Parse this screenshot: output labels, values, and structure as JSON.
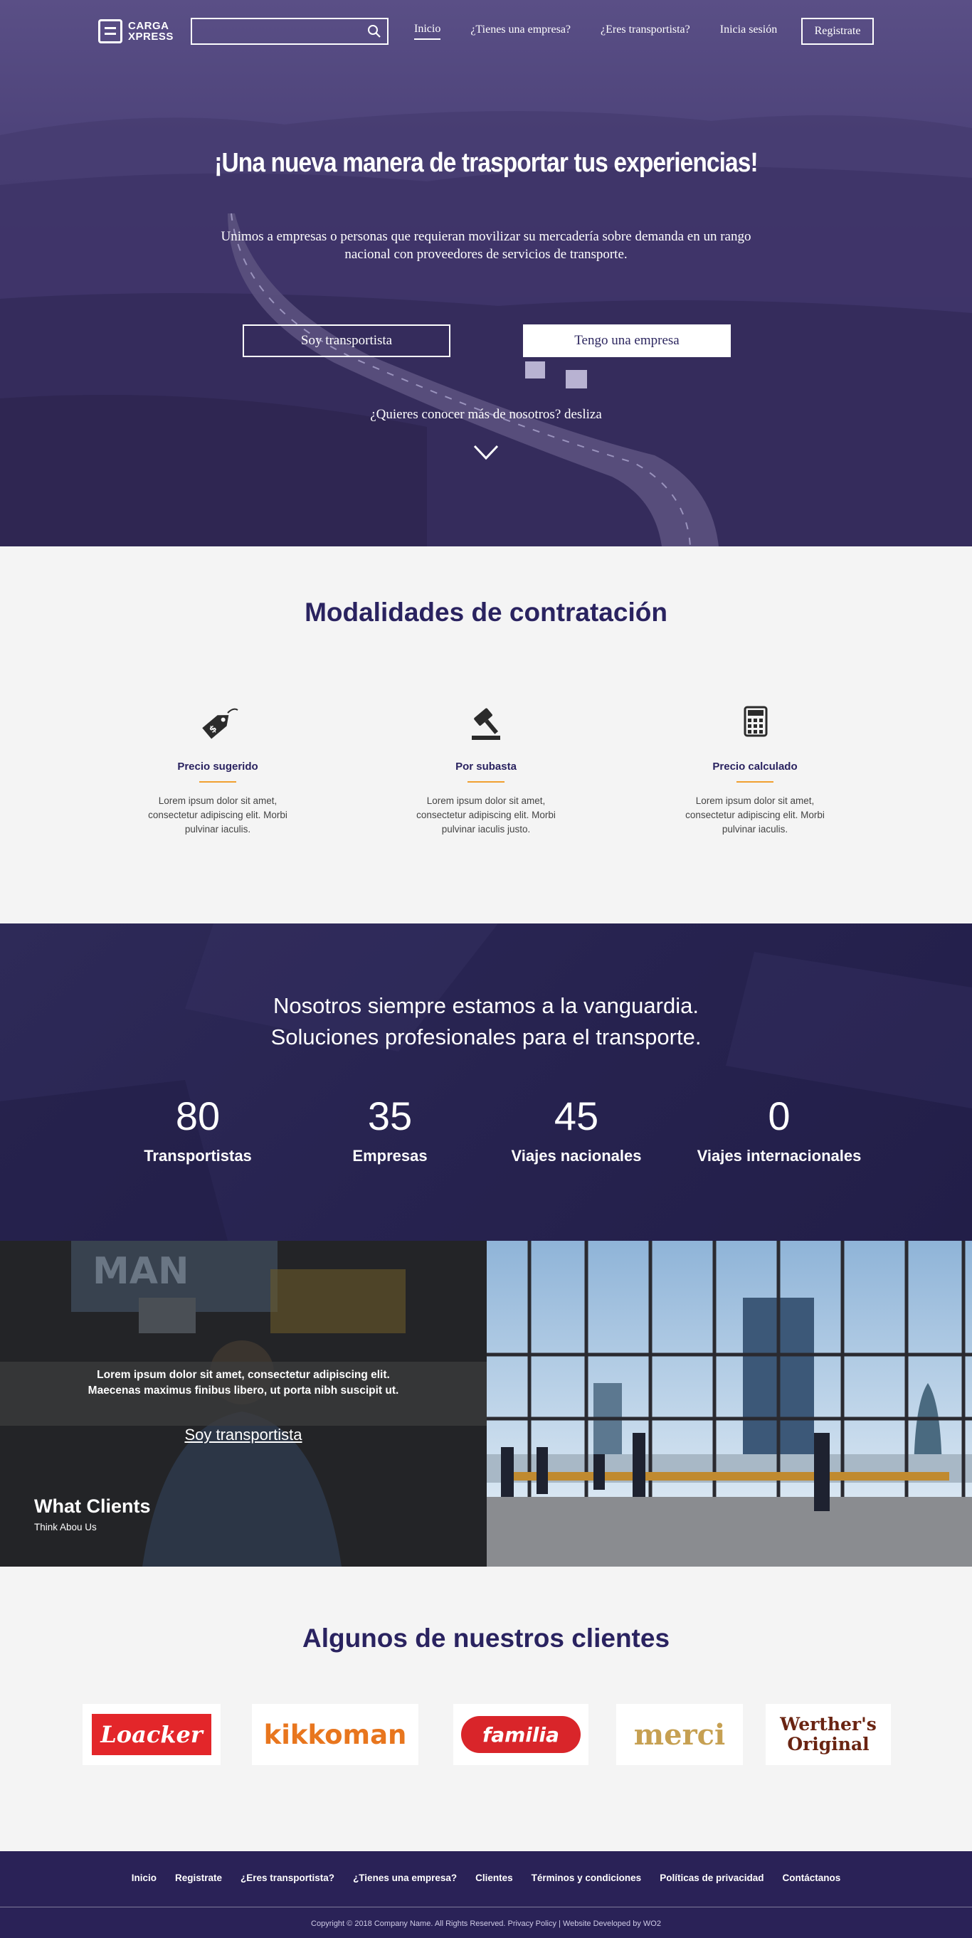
{
  "nav": {
    "logo_line1": "CARGA",
    "logo_line2": "XPRESS",
    "search_placeholder": "",
    "links": [
      "Inicio",
      "¿Tienes una empresa?",
      "¿Eres transportista?",
      "Inicia sesión"
    ],
    "register": "Registrate"
  },
  "hero": {
    "title": "¡Una nueva manera de trasportar tus experiencias!",
    "subtitle": "Unimos a empresas o personas que requieran movilizar su mercadería sobre demanda en un rango nacional con proveedores de servicios de transporte.",
    "btn_transportista": "Soy transportista",
    "btn_empresa": "Tengo una empresa",
    "scroll_text": "¿Quieres conocer más de nosotros? desliza"
  },
  "modes": {
    "title": "Modalidades de contratación",
    "items": [
      {
        "name": "Precio sugerido",
        "icon": "price-tag-icon",
        "desc": "Lorem ipsum dolor sit amet, consectetur adipiscing elit. Morbi pulvinar iaculis."
      },
      {
        "name": "Por subasta",
        "icon": "gavel-icon",
        "desc": "Lorem ipsum dolor sit amet, consectetur adipiscing elit. Morbi pulvinar iaculis justo."
      },
      {
        "name": "Precio calculado",
        "icon": "calculator-icon",
        "desc": "Lorem ipsum dolor sit amet, consectetur adipiscing elit. Morbi pulvinar iaculis."
      }
    ]
  },
  "stats": {
    "heading_line1": "Nosotros siempre estamos a la vanguardia.",
    "heading_line2": "Soluciones profesionales para el transporte.",
    "items": [
      {
        "value": "80",
        "label": "Transportistas"
      },
      {
        "value": "35",
        "label": "Empresas"
      },
      {
        "value": "45",
        "label": "Viajes nacionales"
      },
      {
        "value": "0",
        "label": "Viajes internacionales"
      }
    ]
  },
  "split": {
    "text_line1": "Lorem ipsum dolor sit amet, consectetur adipiscing elit.",
    "text_line2": "Maecenas maximus finibus libero, ut porta nibh suscipit ut.",
    "link": "Soy transportista",
    "caption_title": "What Clients",
    "caption_sub": "Think Abou Us",
    "truck_brand": "MAN"
  },
  "clients": {
    "title": "Algunos de nuestros clientes",
    "logos": [
      "Loacker",
      "kikkoman",
      "familia",
      "merci",
      "Werther's Original"
    ]
  },
  "footer": {
    "links": [
      "Inicio",
      "Registrate",
      "¿Eres transportista?",
      "¿Tienes una empresa?",
      "Clientes",
      "Términos y condiciones",
      "Políticas de privacidad",
      "Contáctanos"
    ],
    "copyright": "Copyright © 2018 Company Name. All Rights Reserved. Privacy Policy   |   Website Developed by WO2"
  },
  "colors": {
    "brand_purple": "#2a2360",
    "accent_orange": "#f0a030",
    "footer_bg": "#2a2257"
  }
}
